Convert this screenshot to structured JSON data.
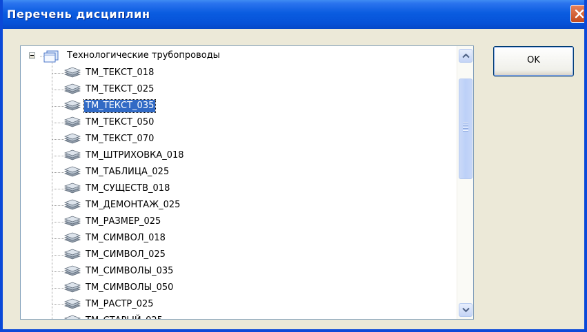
{
  "window": {
    "title": "Перечень дисциплин"
  },
  "tree": {
    "root_label": "Технологические трубопроводы",
    "items": [
      {
        "label": "ТМ_ТЕКСТ_018"
      },
      {
        "label": "ТМ_ТЕКСТ_025"
      },
      {
        "label": "ТМ_ТЕКСТ_035",
        "selected": true
      },
      {
        "label": "ТМ_ТЕКСТ_050"
      },
      {
        "label": "ТМ_ТЕКСТ_070"
      },
      {
        "label": "ТМ_ШТРИХОВКА_018"
      },
      {
        "label": "ТМ_ТАБЛИЦА_025"
      },
      {
        "label": "ТМ_СУЩЕСТВ_018"
      },
      {
        "label": "ТМ_ДЕМОНТАЖ_025"
      },
      {
        "label": "ТМ_РАЗМЕР_025"
      },
      {
        "label": "ТМ_СИМВОЛ_018"
      },
      {
        "label": "ТМ_СИМВОЛ_025"
      },
      {
        "label": "ТМ_СИМВОЛЫ_035"
      },
      {
        "label": "ТМ_СИМВОЛЫ_050"
      },
      {
        "label": "ТМ_РАСТР_025"
      },
      {
        "label": "ТМ_СТАРЫЙ_025"
      }
    ]
  },
  "buttons": {
    "ok_label": "OK"
  },
  "colors": {
    "titlebar": "#0652d8",
    "selection": "#316ac5",
    "close": "#d8582c"
  },
  "icons": {
    "close": "close-icon",
    "root": "root-folder-icon",
    "item": "layer-stack-icon"
  }
}
